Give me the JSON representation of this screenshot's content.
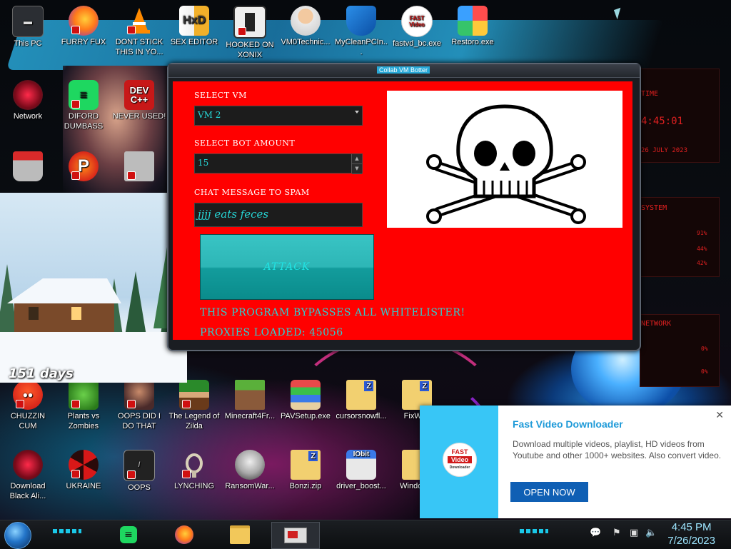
{
  "desktop": {
    "icons": [
      {
        "label": "This PC"
      },
      {
        "label": "FURRY FUX"
      },
      {
        "label": "DONT STICK THIS IN YO..."
      },
      {
        "label": "SEX EDITOR"
      },
      {
        "label": "HOOKED ON XONIX"
      },
      {
        "label": "VM0Technic..."
      },
      {
        "label": "MyCleanPCIn..."
      },
      {
        "label": "fastvd_bc.exe"
      },
      {
        "label": "Restoro.exe"
      },
      {
        "label": "Network"
      },
      {
        "label": "DIFORD DUMBASS"
      },
      {
        "label": "NEVER USED!"
      },
      {
        "label": "CHUZZIN CUM"
      },
      {
        "label": "Plants vs Zombies"
      },
      {
        "label": "OOPS DID I DO THAT"
      },
      {
        "label": "The Legend of Zilda"
      },
      {
        "label": "Minecraft4Fr..."
      },
      {
        "label": "PAVSetup.exe"
      },
      {
        "label": "cursorsnowfl..."
      },
      {
        "label": "FixWi..."
      },
      {
        "label": "Download Black Ali..."
      },
      {
        "label": "UKRAINE"
      },
      {
        "label": "OOPS"
      },
      {
        "label": "LYNCHING"
      },
      {
        "label": "RansomWar..."
      },
      {
        "label": "Bonzi.zip"
      },
      {
        "label": "driver_boost..."
      },
      {
        "label": "Window..."
      }
    ]
  },
  "bot_window": {
    "title": "Collab VM Botter",
    "select_vm_label": "SELECT VM",
    "select_vm_value": "VM 2",
    "bot_amount_label": "SELECT BOT AMOUNT",
    "bot_amount_value": "15",
    "chat_label": "CHAT MESSAGE TO SPAM",
    "chat_value": "jjjj eats feces",
    "attack_label": "ATTACK",
    "info_bypass": "THIS PROGRAM BYPASSES ALL WHITELISTER!",
    "info_proxies": "PROXIES LOADED: 45056"
  },
  "days_widget": {
    "label": "151 days"
  },
  "rainmeter": {
    "time_label": "TIME",
    "time_value": "4:45:01",
    "date_value": "26 JULY 2023",
    "system_label": "SYSTEM",
    "cpu": "91%",
    "ram": "44%",
    "swap": "42%",
    "network_label": "NETWORK",
    "net_up": "0%",
    "net_down": "0%"
  },
  "notification": {
    "title": "Fast Video Downloader",
    "body": "Download multiple videos, playlist, HD videos from Youtube and other 1000+ websites. Also convert video.",
    "button": "OPEN NOW",
    "logo_line1": "FAST",
    "logo_line2": "Video",
    "logo_line3": "Downloader"
  },
  "taskbar": {
    "time": "4:45 PM",
    "date": "7/26/2023"
  },
  "colors": {
    "window_client": "#ff0000",
    "field_text": "#26d4d4",
    "attack_button": "#2db6b6",
    "notif_accent": "#38c6f6",
    "notif_button": "#0f5fb4"
  }
}
